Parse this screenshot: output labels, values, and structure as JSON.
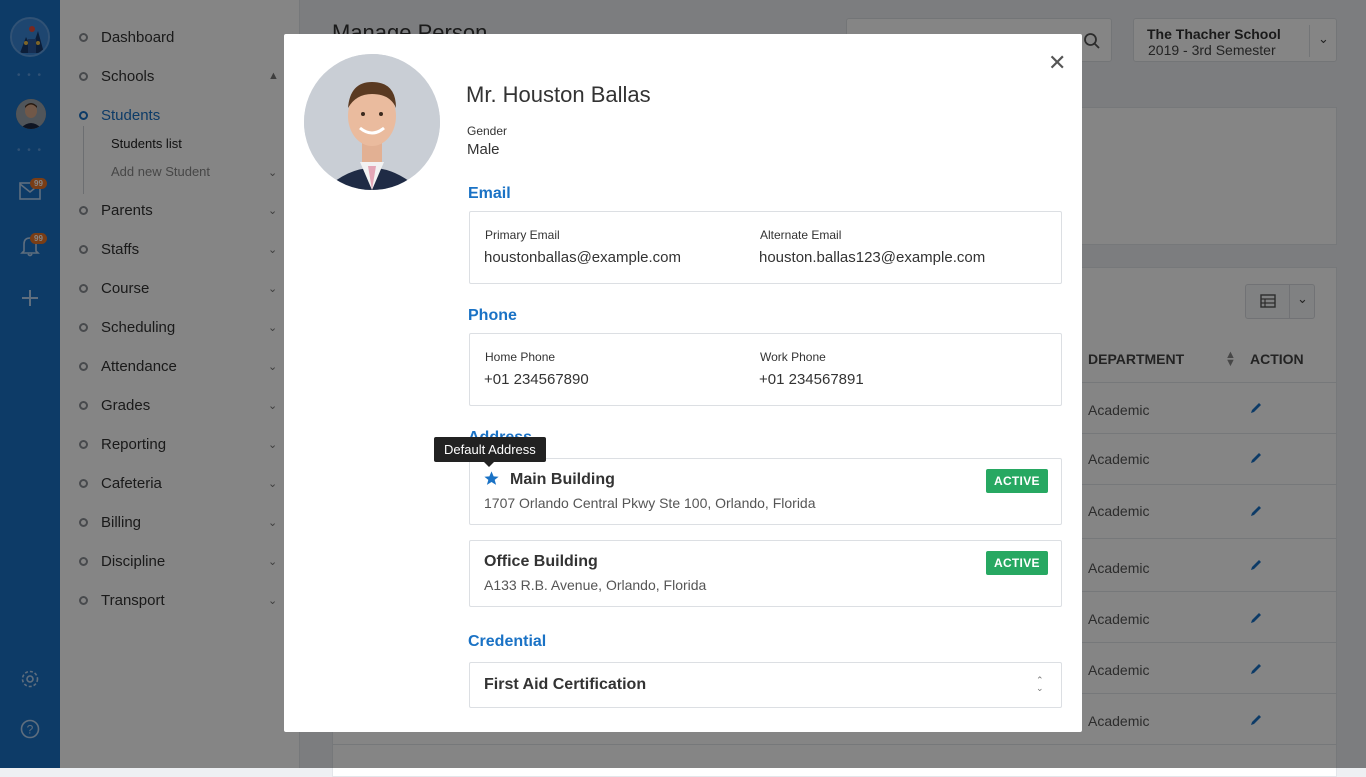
{
  "sidebar": {
    "mail_badge": "99",
    "bell_badge": "99",
    "menu": [
      {
        "label": "Dashboard"
      },
      {
        "label": "Schools"
      },
      {
        "label": "Students"
      },
      {
        "label": "Parents"
      },
      {
        "label": "Staffs"
      },
      {
        "label": "Course"
      },
      {
        "label": "Scheduling"
      },
      {
        "label": "Attendance"
      },
      {
        "label": "Grades"
      },
      {
        "label": "Reporting"
      },
      {
        "label": "Cafeteria"
      },
      {
        "label": "Billing"
      },
      {
        "label": "Discipline"
      },
      {
        "label": "Transport"
      }
    ],
    "students_sub": [
      "Students list",
      "Add new Student"
    ]
  },
  "page": {
    "title": "Manage Person",
    "school_name": "The Thacher School",
    "school_term": "2019 - 3rd Semester",
    "table_headers": {
      "department": "DEPARTMENT",
      "action": "ACTION"
    },
    "department_values": [
      "Academic",
      "Academic",
      "Academic",
      "Academic",
      "Academic",
      "Academic",
      "Academic"
    ]
  },
  "modal": {
    "name": "Mr. Houston Ballas",
    "gender_label": "Gender",
    "gender_value": "Male",
    "email_section": "Email",
    "primary_email_label": "Primary Email",
    "primary_email": "houstonballas@example.com",
    "alternate_email_label": "Alternate Email",
    "alternate_email": "houston.ballas123@example.com",
    "phone_section": "Phone",
    "home_phone_label": "Home Phone",
    "home_phone": "+01 234567890",
    "work_phone_label": "Work Phone",
    "work_phone": "+01 234567891",
    "address_section": "Address",
    "tooltip": "Default Address",
    "addresses": [
      {
        "title": "Main Building",
        "line": "1707 Orlando Central Pkwy Ste 100, Orlando, Florida",
        "status": "ACTIVE"
      },
      {
        "title": "Office Building",
        "line": "A133 R.B. Avenue, Orlando, Florida",
        "status": "ACTIVE"
      }
    ],
    "credential_section": "Credential",
    "credential_value": "First Aid Certification"
  },
  "colors": {
    "accent": "#1a72c5",
    "active_badge": "#27a862",
    "notification_badge": "#e8752a"
  }
}
